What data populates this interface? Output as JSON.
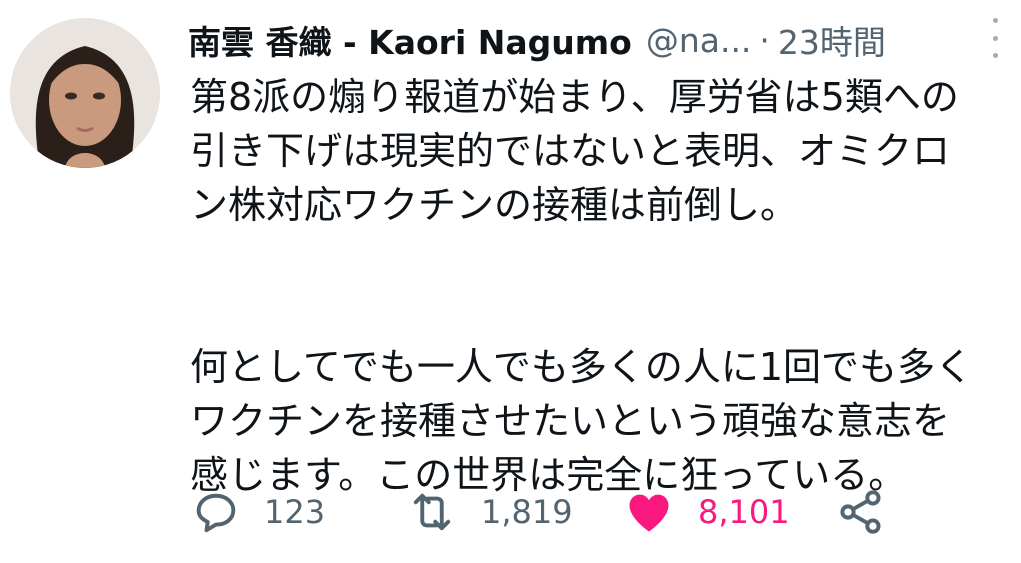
{
  "author": {
    "display_name": "南雲 香織 - Kaori Nagumo",
    "handle": "@na...",
    "separator": "·",
    "time": "23時間"
  },
  "tweet": {
    "lines_p1": [
      "第8派の煽り報道が始まり、厚労省は5類への",
      "引き下げは現実的ではないと表明、オミクロ",
      "ン株対応ワクチンの接種は前倒し。"
    ],
    "lines_p2": [
      "何としてでも一人でも多くの人に1回でも多く",
      "ワクチンを接種させたいという頑強な意志を",
      "感じます。この世界は完全に狂っている。"
    ]
  },
  "actions": {
    "reply_count": "123",
    "retweet_count": "1,819",
    "like_count": "8,101",
    "like_color": "#f91880",
    "icons": [
      "reply-icon",
      "retweet-icon",
      "heart-icon",
      "share-icon"
    ]
  }
}
